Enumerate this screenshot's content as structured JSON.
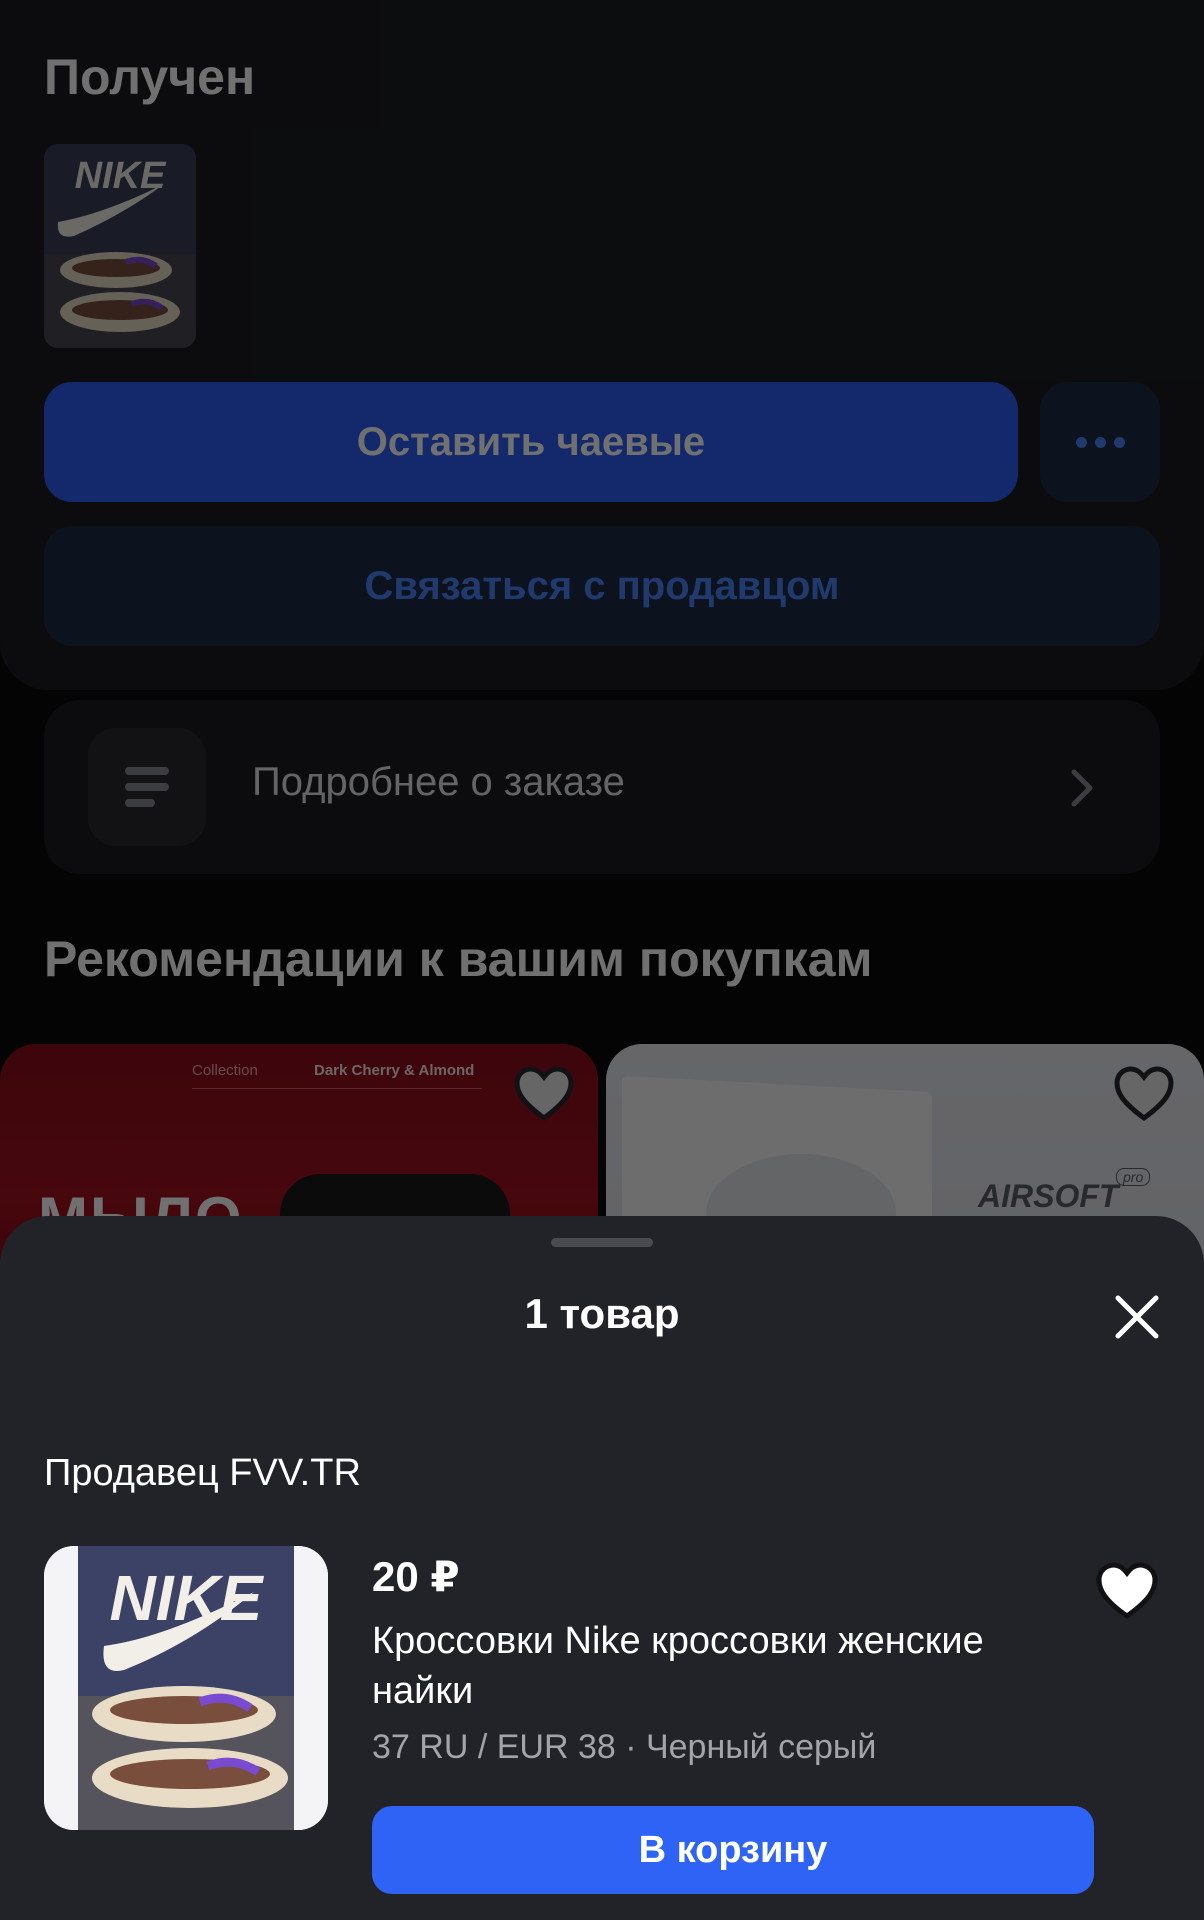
{
  "order": {
    "status": "Получен",
    "tip_button": "Оставить чаевые",
    "contact_button": "Связаться с продавцом",
    "details_label": "Подробнее о заказе"
  },
  "recommendations": {
    "title": "Рекомендации к вашим покупкам",
    "cards": [
      {
        "collection_label": "Collection",
        "collection_name": "Dark Cherry & Almond",
        "headline": "МЫЛО"
      },
      {
        "brand": "AIRSOFT",
        "badge": "pro"
      }
    ]
  },
  "sheet": {
    "title": "1 товар",
    "seller": "Продавец FVV.TR",
    "product": {
      "price": "20 ₽",
      "title": "Кроссовки Nike кроссовки женские найки",
      "variant": "37 RU / EUR 38 · Черный серый",
      "image_brand_text": "NIKE",
      "cart_button": "В корзину"
    }
  },
  "colors": {
    "accent": "#2f63f5",
    "accent_soft": "#1d2a44",
    "accent_text": "#4d84f7",
    "sheet_bg": "#222328",
    "card_bg": "#1c1d21"
  },
  "icons": [
    "more-dots-icon",
    "list-icon",
    "chevron-right-icon",
    "heart-icon",
    "close-icon"
  ]
}
